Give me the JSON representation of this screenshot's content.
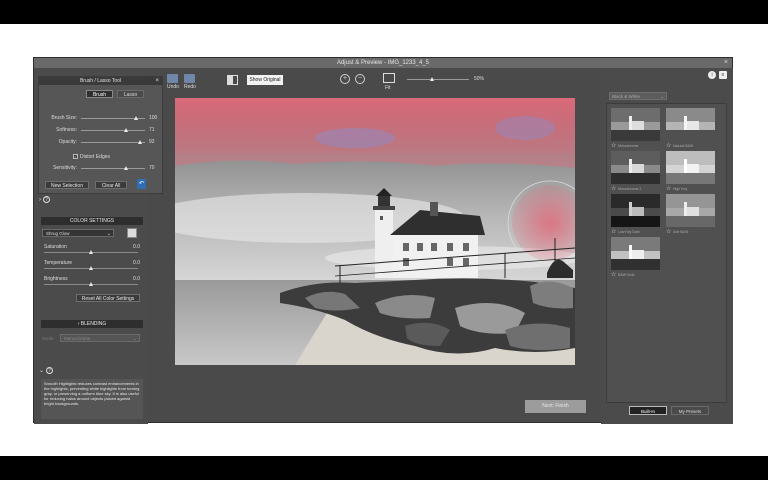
{
  "window": {
    "title": "Adjust & Preview - IMG_1233_4_5",
    "close": "×"
  },
  "brush_panel": {
    "title": "Brush / Lasso Tool",
    "close": "×",
    "tabs": [
      "Brush",
      "Lasso"
    ],
    "active_tab": "Brush",
    "sliders": [
      {
        "label": "Brush Size:",
        "value": "100",
        "fraction": 0.86
      },
      {
        "label": "Softness:",
        "value": "71",
        "fraction": 0.71
      },
      {
        "label": "Opacity:",
        "value": "92",
        "fraction": 0.92
      },
      {
        "label": "Sensitivity:",
        "value": "70",
        "fraction": 0.7
      }
    ],
    "distort_label": "Distort Edges",
    "distort_checked": true,
    "new_selection": "New Selection",
    "clear_all": "Clear All"
  },
  "color_settings": {
    "title": "COLOR SETTINGS",
    "dropdown": "Shrug Glow",
    "sliders": [
      {
        "label": "Saturation",
        "value": "0.0",
        "fraction": 0.5
      },
      {
        "label": "Temperature",
        "value": "0.0",
        "fraction": 0.5
      },
      {
        "label": "Brightness",
        "value": "0.0",
        "fraction": 0.5
      }
    ],
    "reset": "Reset All Color Settings"
  },
  "blending": {
    "title": "BLENDING",
    "mode_label": "Mode:",
    "mode_value": "Monochrome"
  },
  "help_text": "Smooth Highlights reduces contrast enhancements in the highlights, preventing white highlights from turning gray, or preserving a uniform blue sky. It is also useful for reducing halos around objects placed against bright backgrounds.",
  "toolbar": {
    "undo": "Undo",
    "redo": "Redo",
    "show_original": "Show Original",
    "fit": "Fit",
    "zoom_value": "50%",
    "zoom_fraction": 0.4
  },
  "next_button": "Next: Finish",
  "right_panel": {
    "category": "Black & White",
    "presets": [
      {
        "name": "Monochrome"
      },
      {
        "name": "Natural B&W"
      },
      {
        "name": "Monochrome 2"
      },
      {
        "name": "High Key"
      },
      {
        "name": "Low Key Dark"
      },
      {
        "name": "Soft B&W"
      },
      {
        "name": "B&W Vivid"
      }
    ],
    "tabs": [
      "Built-In",
      "My Presets"
    ],
    "active_tab": "Built-In"
  },
  "colors": {
    "accent": "#2f6db5",
    "panel": "#4b4b4b",
    "selection_tint": "#e06a7a"
  }
}
